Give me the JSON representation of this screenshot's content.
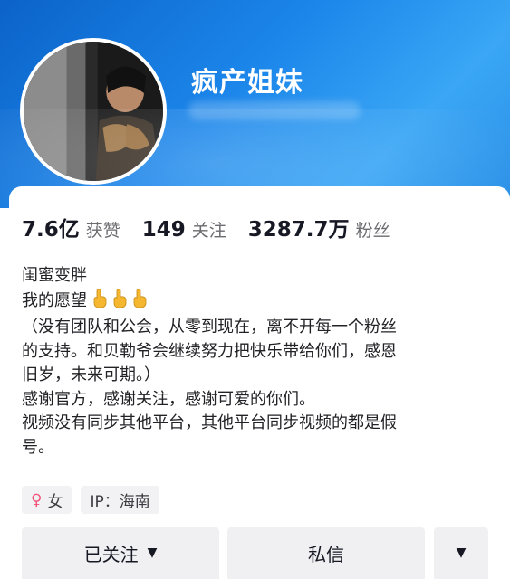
{
  "profile": {
    "nickname": "疯产姐妹",
    "avatar_icon": "avatar-photo-icon"
  },
  "stats": [
    {
      "value": "7.6亿",
      "label": "获赞"
    },
    {
      "value": "149",
      "label": "关注"
    },
    {
      "value": "3287.7万",
      "label": "粉丝"
    }
  ],
  "bio": {
    "lines": [
      "闺蜜变胖",
      "我的愿望",
      "（没有团队和公会，从零到现在，离不开每一个粉丝",
      "的支持。和贝勒爷会继续努力把快乐带给你们，感恩",
      "旧岁，未来可期。）",
      "感谢官方，感谢关注，感谢可爱的你们。",
      "视频没有同步其他平台，其他平台同步视频的都是假",
      "号。"
    ],
    "emoji_icon": "pointing-hand-emoji-icon"
  },
  "tags": {
    "gender": "女",
    "gender_icon": "female-icon",
    "ip": "IP：海南"
  },
  "actions": {
    "follow_label": "已关注",
    "message_label": "私信",
    "caret_icon": "caret-down-icon"
  },
  "colors": {
    "header_blue": "#1c86ea",
    "button_bg": "#f0f0f2",
    "female_pink": "#f0557b"
  }
}
